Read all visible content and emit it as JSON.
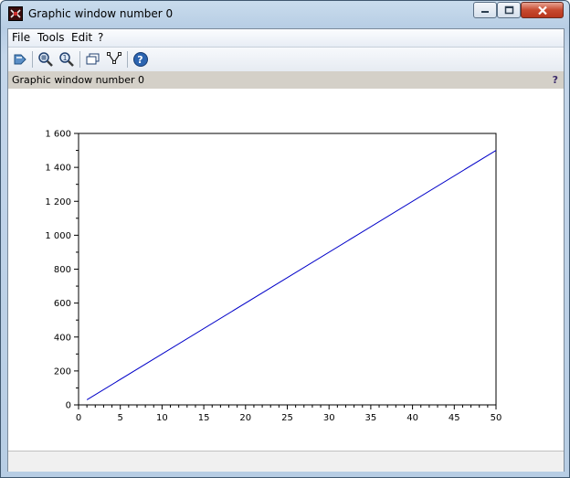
{
  "window": {
    "title": "Graphic window number 0"
  },
  "menu": {
    "file": "File",
    "tools": "Tools",
    "edit": "Edit",
    "help": "?"
  },
  "toolbar": {
    "icons": [
      "rotate-icon",
      "zoom-in-icon",
      "zoom-reset-icon",
      "new-window-icon",
      "datatip-icon",
      "help-icon"
    ]
  },
  "infobar": {
    "text": "Graphic window number 0",
    "help": "?"
  },
  "chart_data": {
    "type": "line",
    "x": [
      1,
      50
    ],
    "series": [
      {
        "values": [
          30,
          1500
        ],
        "color": "#0000c8"
      }
    ],
    "xlim": [
      0,
      50
    ],
    "ylim": [
      0,
      1600
    ],
    "xticks": [
      "0",
      "5",
      "10",
      "15",
      "20",
      "25",
      "30",
      "35",
      "40",
      "45",
      "50"
    ],
    "yticks": [
      "0",
      "200",
      "400",
      "600",
      "800",
      "1 000",
      "1 200",
      "1 400",
      "1 600"
    ],
    "xlabel": "",
    "ylabel": "",
    "title": "",
    "grid": false
  }
}
